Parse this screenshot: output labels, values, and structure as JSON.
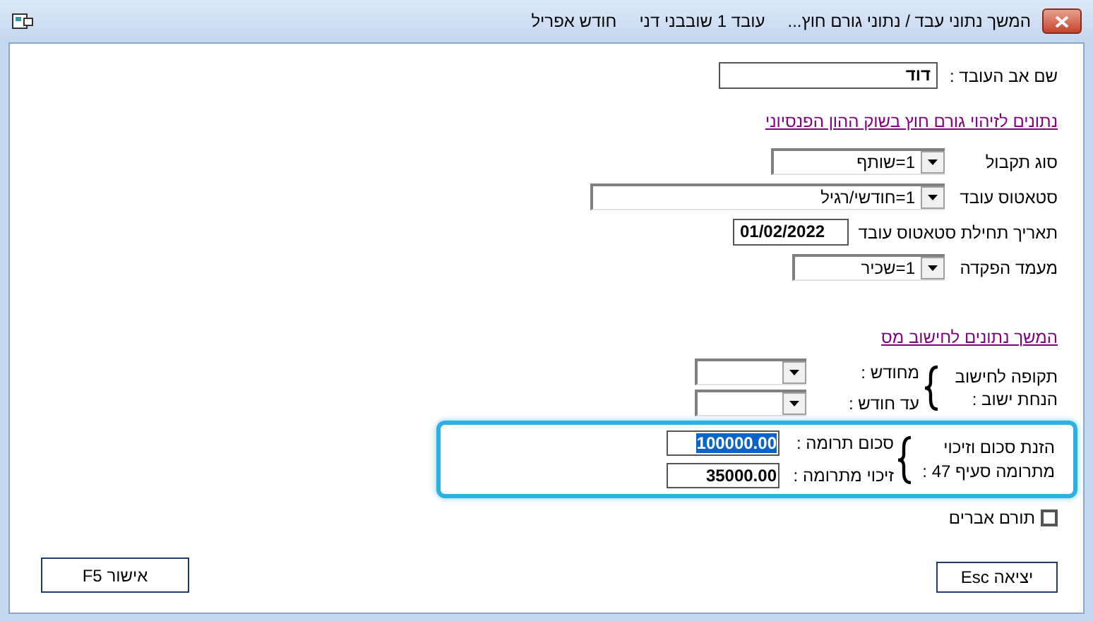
{
  "window": {
    "title_parts": [
      "המשך נתוני עבד / נתוני גורם חוץ...",
      "עובד 1 שובבני דני",
      "חודש אפריל"
    ]
  },
  "father_name": {
    "label": "שם אב העובד :",
    "value": "דוד"
  },
  "pension_link": "נתונים לזיהוי גורם חוץ בשוק ההון הפנסיוני",
  "pension_fields": [
    {
      "kind": "combo",
      "label": "סוג תקבול",
      "value": "1=שותף"
    },
    {
      "kind": "combo",
      "label": "סטאטוס עובד",
      "value": "1=חודשי/רגיל"
    },
    {
      "kind": "date",
      "label": "תאריך תחילת סטאטוס עובד",
      "value": "01/02/2022"
    },
    {
      "kind": "combo",
      "label": "מעמד הפקדה",
      "value": "1=שכיר"
    }
  ],
  "tax_link": "המשך נתונים לחישוב מס",
  "settlement_period": {
    "label_lines": [
      "תקופה לחישוב",
      "הנחת ישוב :"
    ],
    "fields": [
      {
        "label": "מחודש :"
      },
      {
        "label": "עד חודש :"
      }
    ]
  },
  "donation": {
    "highlighted": true,
    "label_lines": [
      "הזנת סכום וזיכוי",
      "מתרומה סעיף 47 :"
    ],
    "fields": [
      {
        "label": "סכום תרומה :",
        "value": "100000.00",
        "selected": true
      },
      {
        "label": "זיכוי מתרומה :",
        "value": "35000.00",
        "selected": false
      }
    ]
  },
  "organ_donor": {
    "label": "תורם אברים",
    "checked": false
  },
  "buttons": [
    {
      "label": "יציאה Esc"
    },
    {
      "label": "אישור F5"
    }
  ]
}
